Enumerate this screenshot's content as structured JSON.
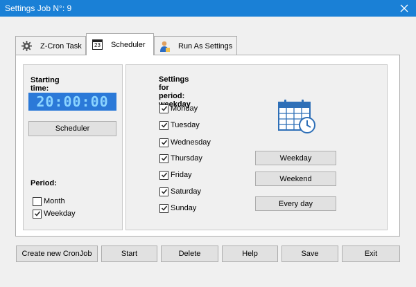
{
  "window": {
    "title": "Settings Job N°: 9",
    "close_icon": "close-icon"
  },
  "tabs": [
    {
      "label": "Z-Cron Task",
      "icon": "gear-icon"
    },
    {
      "label": "Scheduler",
      "icon": "calendar-23-icon",
      "icon_text": "23"
    },
    {
      "label": "Run As Settings",
      "icon": "user-icon"
    }
  ],
  "scheduler": {
    "starting_time_label": "Starting time:",
    "time_value": "20:00:00",
    "scheduler_button": "Scheduler",
    "period_label": "Period:",
    "period_options": [
      {
        "label": "Month",
        "checked": false
      },
      {
        "label": "Weekday",
        "checked": true
      }
    ]
  },
  "period_settings": {
    "heading": "Settings for period: weekday",
    "days": [
      {
        "label": "Monday",
        "checked": true
      },
      {
        "label": "Tuesday",
        "checked": true
      },
      {
        "label": "Wednesday",
        "checked": true
      },
      {
        "label": "Thursday",
        "checked": true
      },
      {
        "label": "Friday",
        "checked": true
      },
      {
        "label": "Saturday",
        "checked": true
      },
      {
        "label": "Sunday",
        "checked": true
      }
    ],
    "buttons": {
      "weekday": "Weekday",
      "weekend": "Weekend",
      "every_day": "Every day"
    },
    "illustration_icon": "calendar-clock-icon"
  },
  "footer": {
    "create": "Create new CronJob",
    "start": "Start",
    "delete": "Delete",
    "help": "Help",
    "save": "Save",
    "exit": "Exit"
  },
  "colors": {
    "titlebar": "#1a80d6",
    "lcd_bg": "#2b79d8",
    "lcd_text": "#8bd4ff",
    "calendar_blue": "#2e6fb7"
  }
}
